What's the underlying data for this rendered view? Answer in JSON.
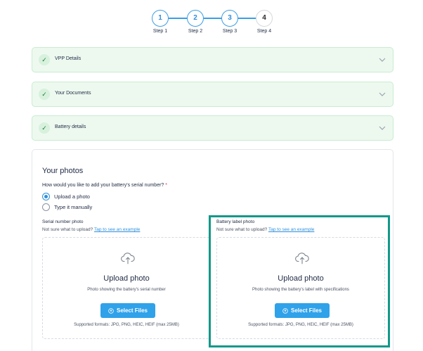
{
  "stepper": {
    "steps": [
      {
        "number": "1",
        "label": "Step 1"
      },
      {
        "number": "2",
        "label": "Step 2"
      },
      {
        "number": "3",
        "label": "Step 3"
      },
      {
        "number": "4",
        "label": "Step 4"
      }
    ]
  },
  "accordions": [
    {
      "title": "VPP Details",
      "check": "✓"
    },
    {
      "title": "Your Documents",
      "check": "✓"
    },
    {
      "title": "Battery details",
      "check": "✓"
    }
  ],
  "photos": {
    "title": "Your photos",
    "question": "How would you like to add your battery's serial number?",
    "required_mark": "*",
    "options": [
      {
        "label": "Upload a photo",
        "selected": true
      },
      {
        "label": "Type it manually",
        "selected": false
      }
    ],
    "serial": {
      "label": "Serial number photo",
      "help": "Not sure what to upload?",
      "link": "Tap to see an example",
      "upload_title": "Upload photo",
      "upload_sub": "Photo showing the battery's serial number",
      "button": "Select Files",
      "formats": "Supported formats: JPG, PNG, HEIC, HEIF (max 25MB)"
    },
    "battery": {
      "label": "Battery label photo",
      "help": "Not sure what to upload?",
      "link": "Tap to see an example",
      "upload_title": "Upload photo",
      "upload_sub": "Photo showing the battery's label with specifications",
      "button": "Select Files",
      "formats": "Supported formats: JPG, PNG, HEIC, HEIF (max 25MB)"
    }
  },
  "colors": {
    "accent": "#2fa2ea",
    "success_bg": "#edf9ef",
    "highlight": "#13988a"
  }
}
